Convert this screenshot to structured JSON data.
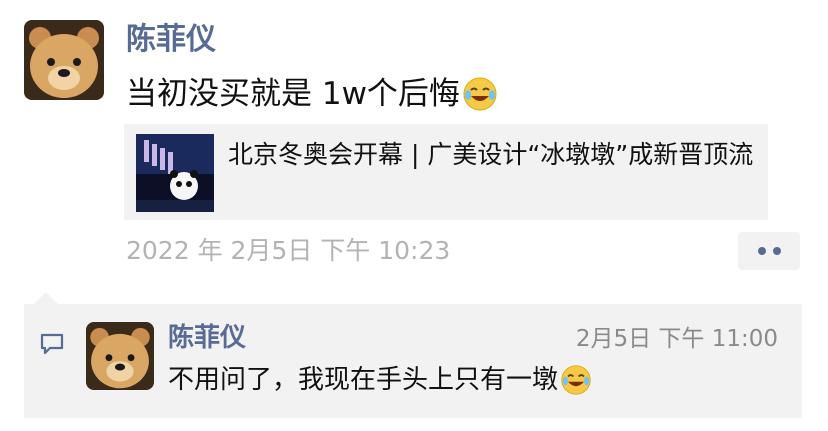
{
  "post": {
    "author": "陈菲仪",
    "text": "当初没买就是 1w个后悔",
    "emoji": "laughing-crying-emoji",
    "link": {
      "title": "北京冬奥会开幕 | 广美设计“冰墩墩”成新晋顶流"
    },
    "time": "2022 年 2月5日  下午 10:23"
  },
  "comment": {
    "author": "陈菲仪",
    "time": "2月5日  下午 11:00",
    "text": "不用问了，我现在手头上只有一墩",
    "emoji": "laughing-crying-emoji"
  },
  "colors": {
    "name_blue": "#576b95",
    "panel_gray": "#f2f2f2",
    "time_gray": "#b3b3b3"
  }
}
